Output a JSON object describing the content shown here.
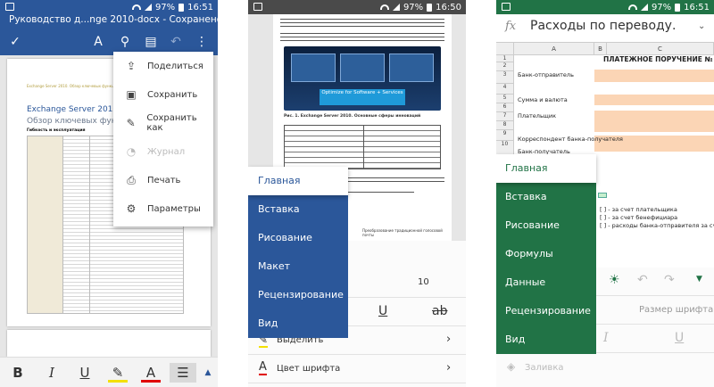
{
  "status": {
    "left": {
      "time": "16:51",
      "battery": "97%"
    },
    "mid": {
      "time": "16:50",
      "battery": "97%"
    },
    "right": {
      "time": "16:51",
      "battery": "97%"
    }
  },
  "word_doc": {
    "title": "Руководство д...nge 2010-docx - Сохранено",
    "page_header": "Exchange Server 2010. Обзор ключевых функций",
    "heading1": "Exchange Server 2010. Опис",
    "heading2": "Обзор ключевых функций",
    "heading3": "Гибкость и эксплуатация",
    "menu": [
      {
        "icon": "share-icon",
        "label": "Поделиться",
        "enabled": true
      },
      {
        "icon": "save-icon",
        "label": "Сохранить",
        "enabled": true
      },
      {
        "icon": "save-as-icon",
        "label": "Сохранить как",
        "enabled": true
      },
      {
        "icon": "history-icon",
        "label": "Журнал",
        "enabled": false
      },
      {
        "icon": "print-icon",
        "label": "Печать",
        "enabled": true
      },
      {
        "icon": "settings-icon",
        "label": "Параметры",
        "enabled": true
      }
    ],
    "format_bar": {
      "bold": "B",
      "italic": "I",
      "underline": "U",
      "font_color": "A"
    }
  },
  "word_ribbon": {
    "diagram_text": "Optimize for Software + Services",
    "caption": "Рис. 1. Exchange Server 2010. Основные сферы инноваций",
    "table_note": "Преобразование традиционной голосовой почты",
    "tabs": [
      "Главная",
      "Вставка",
      "Рисование",
      "Макет",
      "Рецензирование",
      "Вид"
    ],
    "active_tab": "Главная",
    "font_size": "10",
    "highlight_label": "Выделить",
    "font_color_label": "Цвет шрифта",
    "underline": "U",
    "strike": "ab"
  },
  "excel": {
    "formula_label": "fx",
    "formula_value": "Расходы по переводу.",
    "columns": [
      "A",
      "B",
      "C"
    ],
    "sheet_title": "ПЛАТЕЖНОЕ ПОРУЧЕНИЕ №",
    "rows": [
      "1",
      "2",
      "3",
      "4",
      "5",
      "6",
      "7",
      "8",
      "9",
      "10"
    ],
    "cells": [
      "Банк-отправитель",
      "Сумма и валюта",
      "Плательщик",
      "Корреспондент банка-получателя",
      "Банк-получатель"
    ],
    "options": [
      "[ ] - за счет плательщика",
      "[ ] - за счет бенефициара",
      "[ ] - расходы банка-отправителя за счет пла"
    ],
    "tabs": [
      "Главная",
      "Вставка",
      "Рисование",
      "Формулы",
      "Данные",
      "Рецензирование",
      "Вид"
    ],
    "active_tab": "Главная",
    "font_size_placeholder": "Размер шрифта",
    "fill_label": "Заливка"
  },
  "colors": {
    "word": "#2b579a",
    "excel": "#217346"
  }
}
